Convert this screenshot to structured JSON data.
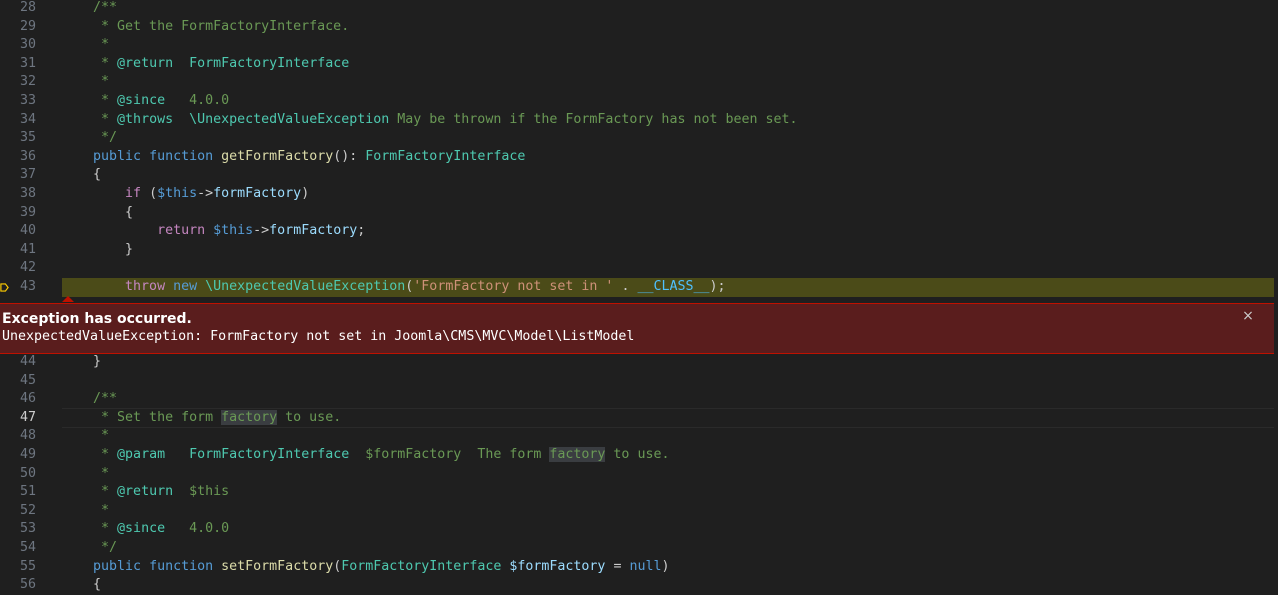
{
  "colors": {
    "background": "#1f1f1f",
    "exception_bg": "#5a1d1d",
    "exception_border": "#be1100",
    "stop_highlight": "#4b4b18"
  },
  "exception": {
    "title": "Exception has occurred.",
    "message": "UnexpectedValueException: FormFactory not set in Joomla\\CMS\\MVC\\Model\\ListModel",
    "close_icon": "×"
  },
  "lines": [
    {
      "n": "28",
      "segs": [
        [
          "cm",
          "    /**"
        ]
      ]
    },
    {
      "n": "29",
      "segs": [
        [
          "cm",
          "     * Get the FormFactoryInterface."
        ]
      ]
    },
    {
      "n": "30",
      "segs": [
        [
          "cm",
          "     *"
        ]
      ]
    },
    {
      "n": "31",
      "segs": [
        [
          "cm",
          "     * "
        ],
        [
          "cmtag",
          "@return"
        ],
        [
          "cm",
          "  "
        ],
        [
          "cmtag",
          "FormFactoryInterface"
        ]
      ]
    },
    {
      "n": "32",
      "segs": [
        [
          "cm",
          "     *"
        ]
      ]
    },
    {
      "n": "33",
      "segs": [
        [
          "cm",
          "     * "
        ],
        [
          "cmtag",
          "@since"
        ],
        [
          "cm",
          "   4.0.0"
        ]
      ]
    },
    {
      "n": "34",
      "segs": [
        [
          "cm",
          "     * "
        ],
        [
          "cmtag",
          "@throws"
        ],
        [
          "cm",
          "  "
        ],
        [
          "cmtag",
          "\\UnexpectedValueException"
        ],
        [
          "cm",
          " May be thrown if the FormFactory has not been set."
        ]
      ]
    },
    {
      "n": "35",
      "segs": [
        [
          "cm",
          "     */"
        ]
      ]
    },
    {
      "n": "36",
      "segs": [
        [
          "kw",
          "    public"
        ],
        [
          "punc",
          " "
        ],
        [
          "kw",
          "function"
        ],
        [
          "punc",
          " "
        ],
        [
          "fn",
          "getFormFactory"
        ],
        [
          "punc",
          "(): "
        ],
        [
          "typ",
          "FormFactoryInterface"
        ]
      ]
    },
    {
      "n": "37",
      "segs": [
        [
          "punc",
          "    {"
        ]
      ]
    },
    {
      "n": "38",
      "segs": [
        [
          "ctrl",
          "        if"
        ],
        [
          "punc",
          " ("
        ],
        [
          "kw",
          "$this"
        ],
        [
          "punc",
          "->"
        ],
        [
          "var",
          "formFactory"
        ],
        [
          "punc",
          ")"
        ]
      ]
    },
    {
      "n": "39",
      "segs": [
        [
          "punc",
          "        {"
        ]
      ]
    },
    {
      "n": "40",
      "segs": [
        [
          "ctrl",
          "            return"
        ],
        [
          "punc",
          " "
        ],
        [
          "kw",
          "$this"
        ],
        [
          "punc",
          "->"
        ],
        [
          "var",
          "formFactory"
        ],
        [
          "punc",
          ";"
        ]
      ]
    },
    {
      "n": "41",
      "segs": [
        [
          "punc",
          "        }"
        ]
      ]
    },
    {
      "n": "42",
      "segs": [
        [
          "punc",
          ""
        ]
      ]
    },
    {
      "n": "43",
      "segs": [
        [
          "ctrl",
          "        throw"
        ],
        [
          "punc",
          " "
        ],
        [
          "kw",
          "new"
        ],
        [
          "punc",
          " "
        ],
        [
          "typ",
          "\\UnexpectedValueException"
        ],
        [
          "punc",
          "("
        ],
        [
          "str",
          "'FormFactory not set in '"
        ],
        [
          "punc",
          " . "
        ],
        [
          "const",
          "__CLASS__"
        ],
        [
          "punc",
          ");"
        ]
      ]
    },
    {
      "n": "44",
      "segs": [
        [
          "punc",
          "    }"
        ]
      ]
    },
    {
      "n": "45",
      "segs": [
        [
          "punc",
          ""
        ]
      ]
    },
    {
      "n": "46",
      "segs": [
        [
          "cm",
          "    /**"
        ]
      ]
    },
    {
      "n": "47",
      "segs": [
        [
          "cm",
          "     * Set the form "
        ],
        [
          "cmhl",
          "factory"
        ],
        [
          "cm",
          " to use."
        ]
      ]
    },
    {
      "n": "48",
      "segs": [
        [
          "cm",
          "     *"
        ]
      ]
    },
    {
      "n": "49",
      "segs": [
        [
          "cm",
          "     * "
        ],
        [
          "cmtag",
          "@param"
        ],
        [
          "cm",
          "   "
        ],
        [
          "cmtag",
          "FormFactoryInterface"
        ],
        [
          "cm",
          "  $formFactory  The form "
        ],
        [
          "cmhl",
          "factory"
        ],
        [
          "cm",
          " to use."
        ]
      ]
    },
    {
      "n": "50",
      "segs": [
        [
          "cm",
          "     *"
        ]
      ]
    },
    {
      "n": "51",
      "segs": [
        [
          "cm",
          "     * "
        ],
        [
          "cmtag",
          "@return"
        ],
        [
          "cm",
          "  $this"
        ]
      ]
    },
    {
      "n": "52",
      "segs": [
        [
          "cm",
          "     *"
        ]
      ]
    },
    {
      "n": "53",
      "segs": [
        [
          "cm",
          "     * "
        ],
        [
          "cmtag",
          "@since"
        ],
        [
          "cm",
          "   4.0.0"
        ]
      ]
    },
    {
      "n": "54",
      "segs": [
        [
          "cm",
          "     */"
        ]
      ]
    },
    {
      "n": "55",
      "segs": [
        [
          "kw",
          "    public"
        ],
        [
          "punc",
          " "
        ],
        [
          "kw",
          "function"
        ],
        [
          "punc",
          " "
        ],
        [
          "fn",
          "setFormFactory"
        ],
        [
          "punc",
          "("
        ],
        [
          "typ",
          "FormFactoryInterface"
        ],
        [
          "punc",
          " "
        ],
        [
          "var",
          "$formFactory"
        ],
        [
          "punc",
          " = "
        ],
        [
          "kw",
          "null"
        ],
        [
          "punc",
          ")"
        ]
      ]
    },
    {
      "n": "56",
      "segs": [
        [
          "punc",
          "    {"
        ]
      ]
    }
  ]
}
